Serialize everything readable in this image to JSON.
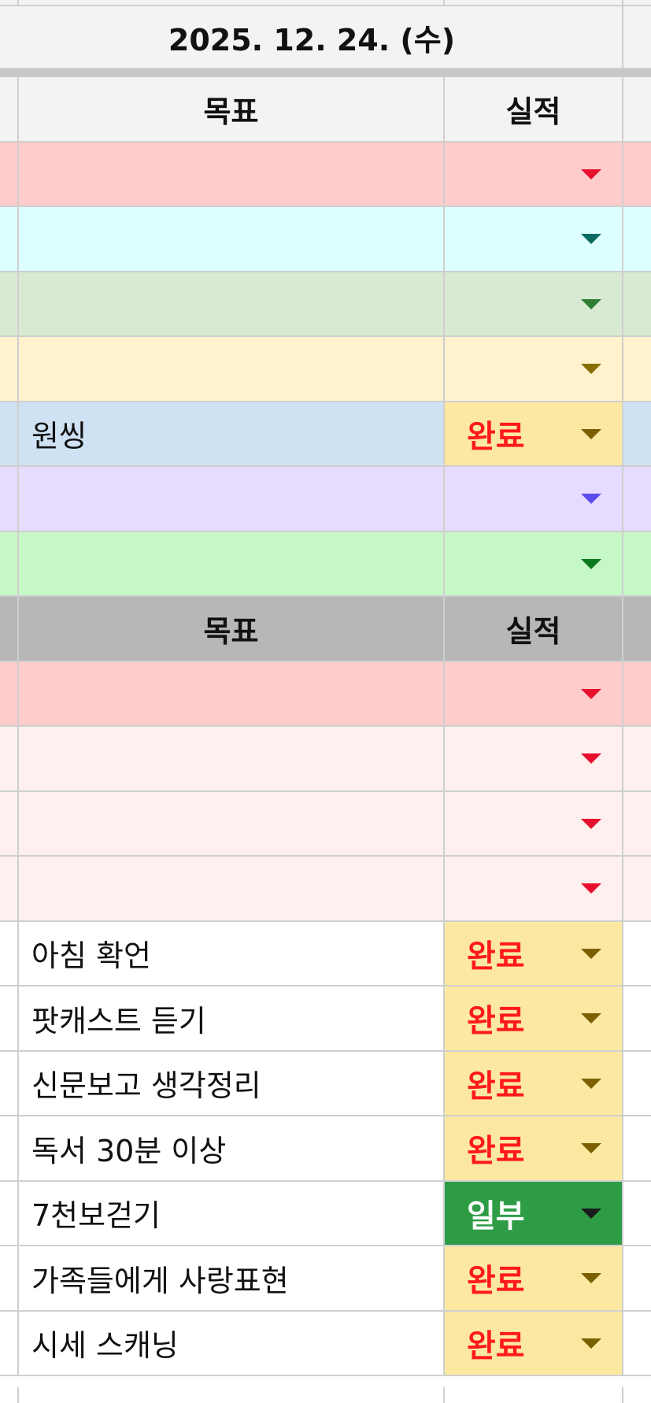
{
  "date_header": "2025. 12. 24. (수)",
  "colors": {
    "grid_line": "#cfcfcf",
    "header_bg": "#f3f3f3",
    "header2_bg": "#b7b7b7",
    "done_bg": "#fde8a2",
    "done_text": "#ff1a1a",
    "partial_bg": "#2e9c45",
    "partial_text": "#ffffff"
  },
  "section1": {
    "header": {
      "goal": "목표",
      "result": "실적"
    },
    "rows": [
      {
        "goal": "",
        "status": "",
        "bg": "#ffcccc",
        "arrow": "#e8112d"
      },
      {
        "goal": "",
        "status": "",
        "bg": "#ddffff",
        "arrow": "#0b6b63"
      },
      {
        "goal": "",
        "status": "",
        "bg": "#d9ead3",
        "arrow": "#2e7d32"
      },
      {
        "goal": "",
        "status": "",
        "bg": "#fff2cc",
        "arrow": "#8a6d00"
      },
      {
        "goal": "원씽",
        "status": "완료",
        "bg": "#cfe2f3",
        "status_bg": "#fde8a2",
        "status_color": "#ff1a1a",
        "arrow": "#7a6000"
      },
      {
        "goal": "",
        "status": "",
        "bg": "#e6dcff",
        "arrow": "#5b4cf0"
      },
      {
        "goal": "",
        "status": "",
        "bg": "#c6f7c6",
        "arrow": "#0a7a1f"
      }
    ]
  },
  "section2": {
    "header": {
      "goal": "목표",
      "result": "실적"
    },
    "rows": [
      {
        "goal": "",
        "status": "",
        "bg": "#ffcccc",
        "arrow": "#e8112d"
      },
      {
        "goal": "",
        "status": "",
        "bg": "#fff0f0",
        "arrow": "#e8112d"
      },
      {
        "goal": "",
        "status": "",
        "bg": "#fff0f0",
        "arrow": "#e8112d"
      },
      {
        "goal": "",
        "status": "",
        "bg": "#fff0f0",
        "arrow": "#e8112d"
      },
      {
        "goal": "아침 확언",
        "status": "완료",
        "bg": "#ffffff",
        "status_bg": "#fde8a2",
        "status_color": "#ff1a1a",
        "arrow": "#7a6000"
      },
      {
        "goal": "팟캐스트 듣기",
        "status": "완료",
        "bg": "#ffffff",
        "status_bg": "#fde8a2",
        "status_color": "#ff1a1a",
        "arrow": "#7a6000"
      },
      {
        "goal": "신문보고 생각정리",
        "status": "완료",
        "bg": "#ffffff",
        "status_bg": "#fde8a2",
        "status_color": "#ff1a1a",
        "arrow": "#7a6000"
      },
      {
        "goal": "독서 30분 이상",
        "status": "완료",
        "bg": "#ffffff",
        "status_bg": "#fde8a2",
        "status_color": "#ff1a1a",
        "arrow": "#7a6000"
      },
      {
        "goal": "7천보걷기",
        "status": "일부",
        "bg": "#ffffff",
        "status_bg": "#2e9c45",
        "status_color": "#ffffff",
        "arrow": "#1b1b1b"
      },
      {
        "goal": "가족들에게 사랑표현",
        "status": "완료",
        "bg": "#ffffff",
        "status_bg": "#fde8a2",
        "status_color": "#ff1a1a",
        "arrow": "#7a6000"
      },
      {
        "goal": "시세 스캐닝",
        "status": "완료",
        "bg": "#ffffff",
        "status_bg": "#fde8a2",
        "status_color": "#ff1a1a",
        "arrow": "#7a6000"
      }
    ]
  }
}
